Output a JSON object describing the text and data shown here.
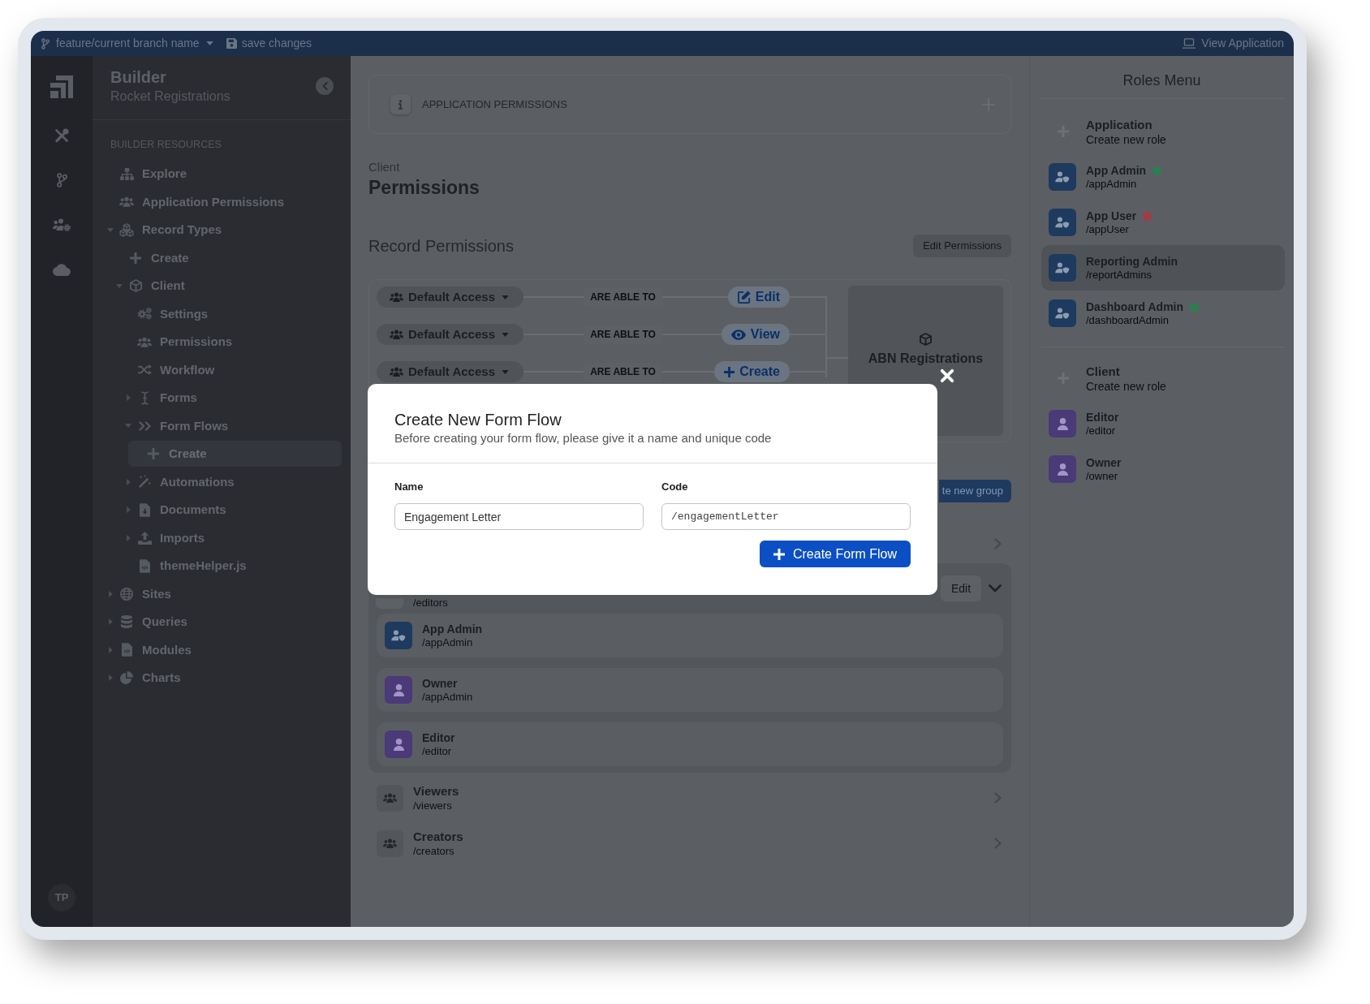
{
  "top_bar": {
    "branch": "feature/current branch name",
    "save": "save changes",
    "view": "View Application"
  },
  "rail": {
    "avatar": "TP"
  },
  "sidebar": {
    "title": "Builder",
    "subtitle": "Rocket Registrations",
    "heading": "BUILDER RESOURCES",
    "items": [
      {
        "label": "Explore",
        "selected": false
      },
      {
        "label": "Application Permissions",
        "selected": false
      },
      {
        "label": "Record Types",
        "selected": false,
        "expanded": true,
        "children": [
          {
            "label": "Create",
            "selected": false
          },
          {
            "label": "Client",
            "selected": false,
            "expanded": true,
            "children": [
              {
                "label": "Settings",
                "selected": false
              },
              {
                "label": "Permissions",
                "selected": false
              },
              {
                "label": "Workflow",
                "selected": false
              },
              {
                "label": "Forms",
                "selected": false,
                "expanded": false
              },
              {
                "label": "Form Flows",
                "selected": false,
                "expanded": true,
                "children": [
                  {
                    "label": "Create",
                    "selected": true
                  }
                ]
              },
              {
                "label": "Automations",
                "selected": false,
                "expanded": false
              },
              {
                "label": "Documents",
                "selected": false,
                "expanded": false
              },
              {
                "label": "Imports",
                "selected": false,
                "expanded": false
              },
              {
                "label": "themeHelper.js",
                "selected": false
              }
            ]
          }
        ]
      },
      {
        "label": "Sites",
        "selected": false,
        "expanded": false
      },
      {
        "label": "Queries",
        "selected": false,
        "expanded": false
      },
      {
        "label": "Modules",
        "selected": false,
        "expanded": false
      },
      {
        "label": "Charts",
        "selected": false,
        "expanded": false
      }
    ]
  },
  "main": {
    "banner": "APPLICATION PERMISSIONS",
    "eyebrow": "Client",
    "title": "Permissions",
    "record_permissions": {
      "title": "Record Permissions",
      "button": "Edit Permissions",
      "rules": [
        {
          "group": "Default Access",
          "relation": "ARE ABLE TO",
          "action": "Edit",
          "kind": "edit"
        },
        {
          "group": "Default Access",
          "relation": "ARE ABLE TO",
          "action": "View",
          "kind": "view"
        },
        {
          "group": "Default Access",
          "relation": "ARE ABLE TO",
          "action": "Create",
          "kind": "create"
        }
      ],
      "target": "ABN Registrations"
    },
    "new_group_button": "te new group",
    "groups": [
      {
        "expanded": false
      },
      {
        "code": "/editors",
        "expanded": true,
        "button": "Edit",
        "roles": [
          {
            "name": "App Admin",
            "code": "/appAdmin",
            "kind": "admin"
          },
          {
            "name": "Owner",
            "code": "/appAdmin",
            "kind": "member"
          },
          {
            "name": "Editor",
            "code": "/editor",
            "kind": "member"
          }
        ]
      },
      {
        "name": "Viewers",
        "code": "/viewers",
        "expanded": false
      },
      {
        "name": "Creators",
        "code": "/creators",
        "expanded": false
      }
    ]
  },
  "modal": {
    "title": "Create New Form Flow",
    "subtitle": "Before creating your form flow, please give it a name and unique code",
    "fields": [
      {
        "label": "Name",
        "value": "Engagement Letter",
        "kind": "text"
      },
      {
        "label": "Code",
        "value": "/engagementLetter",
        "kind": "code"
      }
    ],
    "submit": "Create Form Flow"
  },
  "roles_menu": {
    "title": "Roles Menu",
    "sections": [
      {
        "title": "Application",
        "action": "Create new role",
        "roles": [
          {
            "name": "App Admin",
            "code": "/appAdmin",
            "kind": "admin",
            "selected": false,
            "color": "#2e7d4e"
          },
          {
            "name": "App User",
            "code": "/appUser",
            "kind": "admin",
            "selected": false,
            "color": "#a33b45"
          },
          {
            "name": "Reporting Admin",
            "code": "/reportAdmins",
            "kind": "admin",
            "selected": true
          },
          {
            "name": "Dashboard Admin",
            "code": "/dashboardAdmin",
            "kind": "admin",
            "selected": false,
            "color": "#2e7d4e"
          }
        ]
      },
      {
        "title": "Client",
        "action": "Create new role",
        "roles": [
          {
            "name": "Editor",
            "code": "/editor",
            "kind": "member",
            "selected": false
          },
          {
            "name": "Owner",
            "code": "/owner",
            "kind": "member",
            "selected": false
          }
        ]
      }
    ]
  }
}
